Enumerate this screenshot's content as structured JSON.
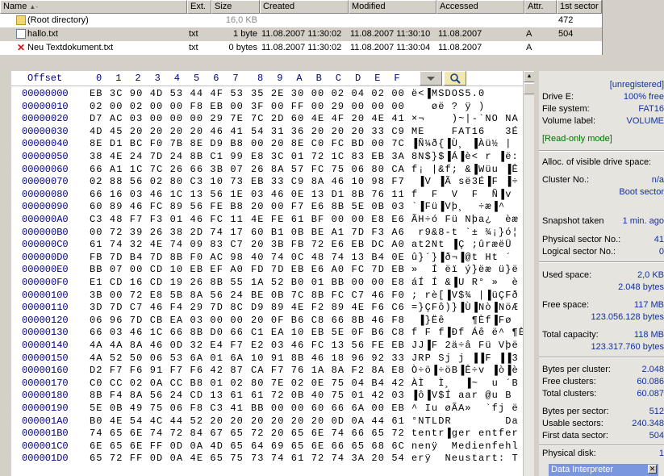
{
  "filelist": {
    "headers": [
      "Name",
      "Ext.",
      "Size",
      "Created",
      "Modified",
      "Accessed",
      "Attr.",
      "1st sector"
    ],
    "sort_marker": "▲-",
    "rows": [
      {
        "name": "(Root directory)",
        "ext": "",
        "size": "16,0 KB",
        "created": "",
        "modified": "",
        "accessed": "",
        "attr": "",
        "sector": "472",
        "icon": "folder-icon"
      },
      {
        "name": "hallo.txt",
        "ext": "txt",
        "size": "1 byte",
        "created": "11.08.2007  11:30:02",
        "modified": "11.08.2007  11:30:10",
        "accessed": "11.08.2007",
        "attr": "A",
        "sector": "504",
        "icon": "text-file-icon"
      },
      {
        "name": "Neu Textdokument.txt",
        "ext": "txt",
        "size": "0 bytes",
        "created": "11.08.2007  11:30:02",
        "modified": "11.08.2007  11:30:04",
        "accessed": "11.08.2007",
        "attr": "A",
        "sector": "",
        "icon": "deleted-file-icon"
      }
    ]
  },
  "hex": {
    "offset_label": "Offset",
    "columns": [
      "0",
      "1",
      "2",
      "3",
      "4",
      "5",
      "6",
      "7",
      "8",
      "9",
      "A",
      "B",
      "C",
      "D",
      "E",
      "F"
    ],
    "rows": [
      {
        "off": "00000000",
        "h1": "EB 3C 90 4D 53 44 4F 53",
        "h2": "35 2E 30 00 02 04 02 00",
        "txt": "ë<▐MSDOS5.0"
      },
      {
        "off": "00000010",
        "h1": "02 00 02 00 00 F8 EB 00",
        "h2": "3F 00 FF 00 29 00 00 00",
        "txt": "   øë ? ÿ )"
      },
      {
        "off": "00000020",
        "h1": "D7 AC 03 00 00 00 29 7E",
        "h2": "7C 2D 60 4E 4F 20 4E 41",
        "txt": "×¬    )~|-`NO NA"
      },
      {
        "off": "00000030",
        "h1": "4D 45 20 20 20 20 46 41",
        "h2": "54 31 36 20 20 20 33 C9",
        "txt": "ME    FAT16   3É"
      },
      {
        "off": "00000040",
        "h1": "8E D1 BC F0 7B 8E D9 B8",
        "h2": "00 20 8E C0 FC BD 00 7C",
        "txt": "▐Ñ¼ð{▐Ù¸ ▐Àü½ |"
      },
      {
        "off": "00000050",
        "h1": "38 4E 24 7D 24 8B C1 99",
        "h2": "E8 3C 01 72 1C 83 EB 3A",
        "txt": "8N$}$▐Á▐è< r ▐ë:"
      },
      {
        "off": "00000060",
        "h1": "66 A1 1C 7C 26 66 3B 07",
        "h2": "26 8A 57 FC 75 06 80 CA",
        "txt": "f¡ |&f; &▐Wüu ▐Ê"
      },
      {
        "off": "00000070",
        "h1": "02 88 56 02 80 C3 10 73",
        "h2": "EB 33 C9 8A 46 10 98 F7",
        "txt": " ▐V ▐Ã së3É▐F ▐÷"
      },
      {
        "off": "00000080",
        "h1": "66 16 03 46 1C 13 56 1E",
        "h2": "03 46 0E 13 D1 8B 76 11",
        "txt": "f  F  V  F  Ñ▐v"
      },
      {
        "off": "00000090",
        "h1": "60 89 46 FC 89 56 FE B8",
        "h2": "20 00 F7 E6 8B 5E 0B 03",
        "txt": "`▐Fü▐Vþ¸  ÷æ▐^"
      },
      {
        "off": "000000A0",
        "h1": "C3 48 F7 F3 01 46 FC 11",
        "h2": "4E FE 61 BF 00 00 E8 E6",
        "txt": "ÃH÷ó Fü Nþa¿  èæ"
      },
      {
        "off": "000000B0",
        "h1": "00 72 39 26 38 2D 74 17",
        "h2": "60 B1 0B BE A1 7D F3 A6",
        "txt": " r9&8-t `± ¾¡}ó¦"
      },
      {
        "off": "000000C0",
        "h1": "61 74 32 4E 74 09 83 C7",
        "h2": "20 3B FB 72 E6 EB DC A0",
        "txt": "at2Nt ▐Ç ;ûræëÜ "
      },
      {
        "off": "000000D0",
        "h1": "FB 7D B4 7D 8B F0 AC 98",
        "h2": "40 74 0C 48 74 13 B4 0E",
        "txt": "û}´}▐ð¬▐@t Ht ´"
      },
      {
        "off": "000000E0",
        "h1": "BB 07 00 CD 10 EB EF A0",
        "h2": "FD 7D EB E6 A0 FC 7D EB",
        "txt": "»  Í ëï ý}ëæ ü}ë"
      },
      {
        "off": "000000F0",
        "h1": "E1 CD 16 CD 19 26 8B 55",
        "h2": "1A 52 B0 01 BB 00 00 E8",
        "txt": "áÍ Í &▐U R° »  è"
      },
      {
        "off": "00000100",
        "h1": "3B 00 72 E8 5B 8A 56 24",
        "h2": "BE 0B 7C 8B FC C7 46 F0",
        "txt": "; rè[▐V$¾ |▐üÇFð"
      },
      {
        "off": "00000110",
        "h1": "3D 7D C7 46 F4 29 7D 8C",
        "h2": "D9 89 4E F2 89 4E F6 C6",
        "txt": "=}ÇFô)}▐Ù▐Nò▐NöÆ"
      },
      {
        "off": "00000120",
        "h1": "06 96 7D CB EA 03 00 00",
        "h2": "20 0F B6 C8 66 8B 46 F8",
        "txt": " ▐}Ëê    ¶Èf▐Fø"
      },
      {
        "off": "00000130",
        "h1": "66 03 46 1C 66 8B D0 66",
        "h2": "C1 EA 10 EB 5E 0F B6 C8",
        "txt": "f F f▐Ðf Áê ë^ ¶È"
      },
      {
        "off": "00000140",
        "h1": "4A 4A 8A 46 0D 32 E4 F7",
        "h2": "E2 03 46 FC 13 56 FE EB",
        "txt": "JJ▐F 2ä÷â Fü Vþë"
      },
      {
        "off": "00000150",
        "h1": "4A 52 50 06 53 6A 01 6A",
        "h2": "10 91 8B 46 18 96 92 33",
        "txt": "JRP Sj j ▐▐F ▐▐3"
      },
      {
        "off": "00000160",
        "h1": "D2 F7 F6 91 F7 F6 42 87",
        "h2": "CA F7 76 1A 8A F2 8A E8",
        "txt": "Ò÷ö▐÷öB▐Ê÷v ▐ò▐è"
      },
      {
        "off": "00000170",
        "h1": "C0 CC 02 0A CC B8 01 02",
        "h2": "80 7E 02 0E 75 04 B4 42",
        "txt": "ÀÌ  Ì¸  ▐~  u ´B"
      },
      {
        "off": "00000180",
        "h1": "8B F4 8A 56 24 CD 13 61",
        "h2": "61 72 0B 40 75 01 42 03",
        "txt": "▐ô▐V$Í aar @u B"
      },
      {
        "off": "00000190",
        "h1": "5E 0B 49 75 06 F8 C3 41",
        "h2": "BB 00 00 60 66 6A 00 EB",
        "txt": "^ Iu øÃA»  `fj ë"
      },
      {
        "off": "000001A0",
        "h1": "B0 4E 54 4C 44 52 20 20",
        "h2": "20 20 20 20 0D 0A 44 61",
        "txt": "°NTLDR        Da"
      },
      {
        "off": "000001B0",
        "h1": "74 65 6E 74 72 84 67 65",
        "h2": "72 20 65 6E 74 66 65 72",
        "txt": "tentr▐ger entfer"
      },
      {
        "off": "000001C0",
        "h1": "6E 65 6E FF 0D 0A 4D 65",
        "h2": "64 69 65 6E 66 65 68 6C",
        "txt": "nenÿ  Medienfehl"
      },
      {
        "off": "000001D0",
        "h1": "65 72 FF 0D 0A 4E 65 75",
        "h2": "73 74 61 72 74 3A 20 54",
        "txt": "erÿ  Neustart: T"
      }
    ]
  },
  "info": {
    "unregistered": "[unregistered]",
    "drive_label": "Drive E:",
    "drive_free": "100% free",
    "fs_label": "File system:",
    "fs_value": "FAT16",
    "vol_label": "Volume label:",
    "vol_value": "VOLUME",
    "readonly": "[Read-only mode]",
    "alloc_label": "Alloc. of visible drive space:",
    "cluster_label": "Cluster No.:",
    "cluster_value": "n/a",
    "boot_sector": "Boot sector",
    "snapshot_label": "Snapshot taken",
    "snapshot_value": "1 min. ago",
    "phys_sector_label": "Physical sector No.:",
    "phys_sector_value": "41",
    "log_sector_label": "Logical sector No.:",
    "log_sector_value": "0",
    "used_label": "Used space:",
    "used_value1": "2,0 KB",
    "used_value2": "2.048 bytes",
    "free_label": "Free space:",
    "free_value1": "117 MB",
    "free_value2": "123.056.128 bytes",
    "total_label": "Total capacity:",
    "total_value1": "118 MB",
    "total_value2": "123.317.760 bytes",
    "bpc_label": "Bytes per cluster:",
    "bpc_value": "2.048",
    "freecl_label": "Free clusters:",
    "freecl_value": "60.086",
    "totcl_label": "Total clusters:",
    "totcl_value": "60.087",
    "bps_label": "Bytes per sector:",
    "bps_value": "512",
    "usable_label": "Usable sectors:",
    "usable_value": "240.348",
    "first_label": "First data sector:",
    "first_value": "504",
    "physdisk_label": "Physical disk:",
    "physdisk_value": "1"
  },
  "data_interpreter": {
    "title": "Data Interpreter",
    "close": "✕"
  }
}
